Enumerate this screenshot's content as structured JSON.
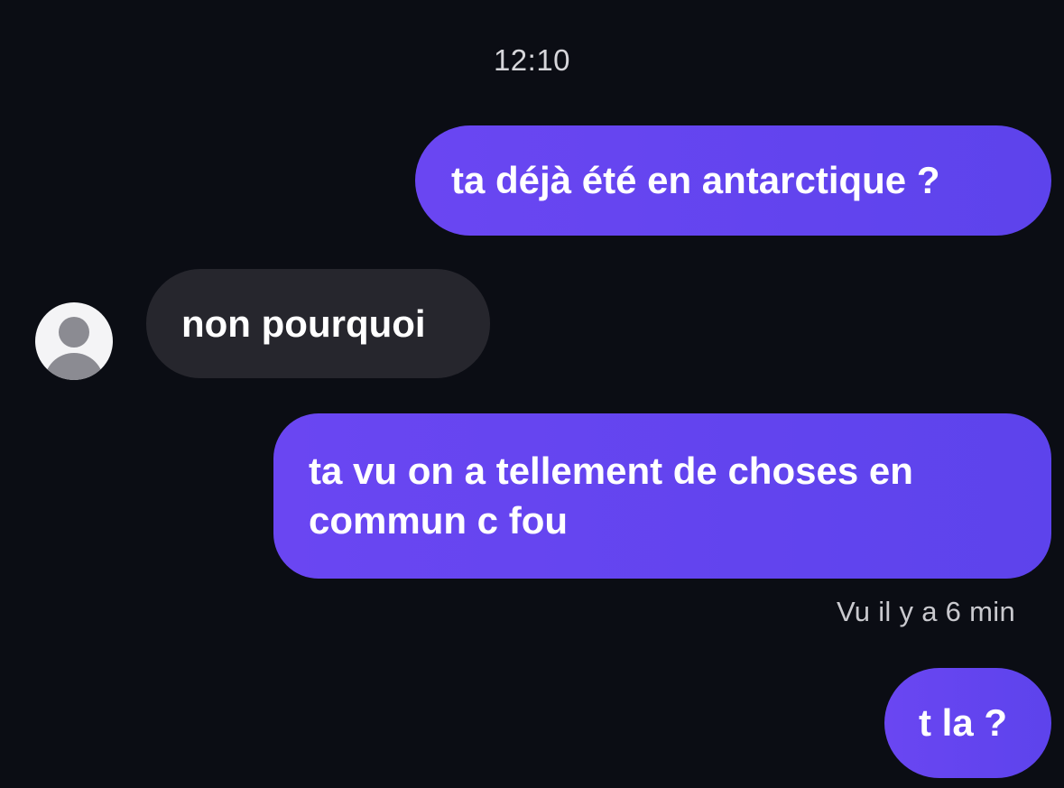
{
  "conversation": {
    "timestamp": "12:10",
    "messages": [
      {
        "direction": "sent",
        "text": "ta déjà été en antarctique ?"
      },
      {
        "direction": "received",
        "text": "non pourquoi"
      },
      {
        "direction": "sent",
        "text": "ta vu on a tellement de choses en commun c fou"
      },
      {
        "direction": "sent",
        "text": "t la ?"
      }
    ],
    "read_receipt": "Vu il y a 6 min",
    "contact_avatar_icon": "default-user-avatar-icon"
  },
  "colors": {
    "background": "#0b0d14",
    "sent_bubble": "#6246f0",
    "received_bubble": "#26262d",
    "text": "#ffffff",
    "meta_text": "#c9c9ce"
  }
}
